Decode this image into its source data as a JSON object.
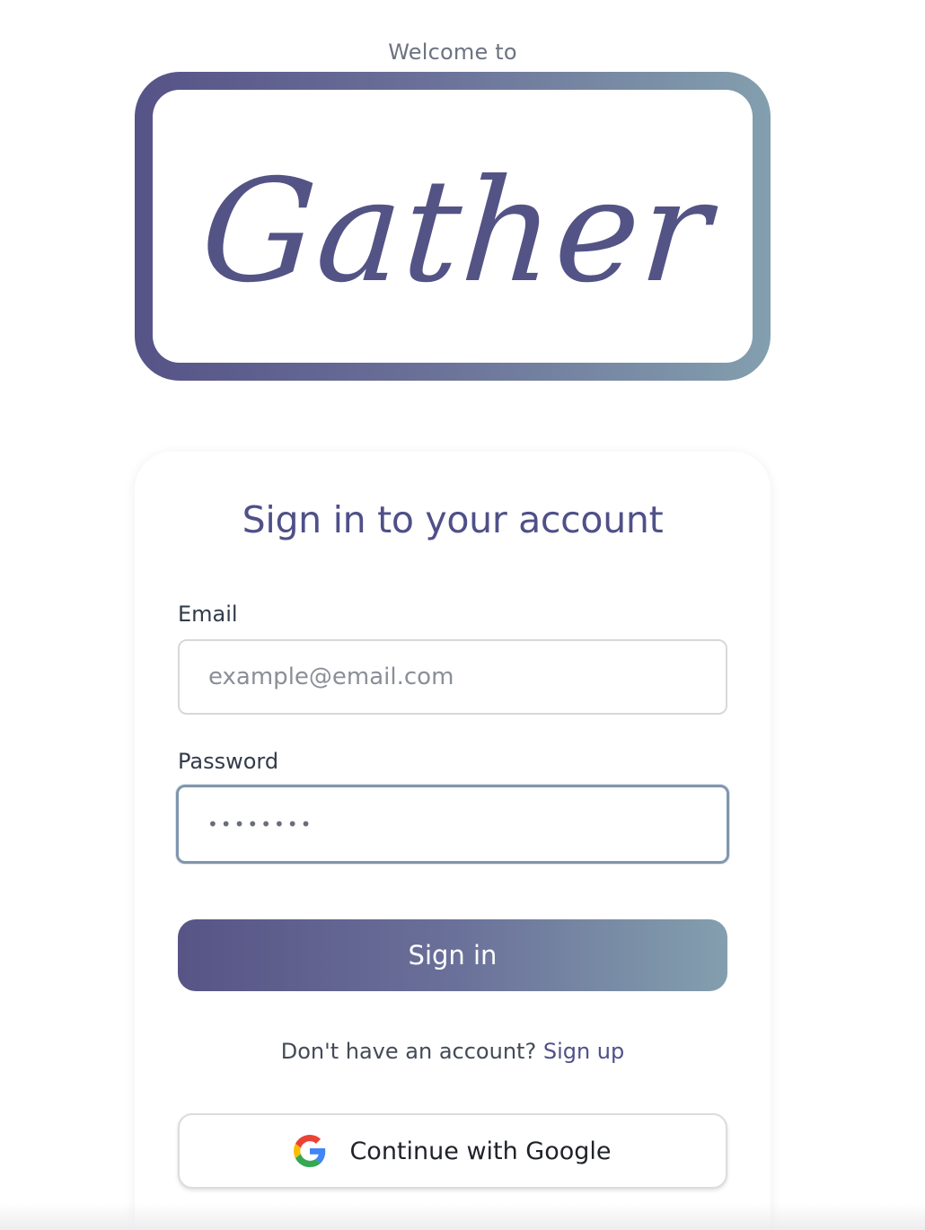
{
  "header": {
    "welcome_text": "Welcome to",
    "logo_text": "Gather"
  },
  "form": {
    "title": "Sign in to your account",
    "email": {
      "label": "Email",
      "placeholder": "example@email.com",
      "value": ""
    },
    "password": {
      "label": "Password",
      "value": "••••••••"
    },
    "signin_label": "Sign in",
    "signup_prompt": "Don't have an account?",
    "signup_link": "Sign up",
    "google_label": "Continue with Google"
  },
  "colors": {
    "brand": "#535386",
    "gradient_start": "#565387",
    "gradient_end": "#839fae",
    "focus_border": "#7f97ae"
  },
  "icons": {
    "google": "google-g-icon"
  }
}
